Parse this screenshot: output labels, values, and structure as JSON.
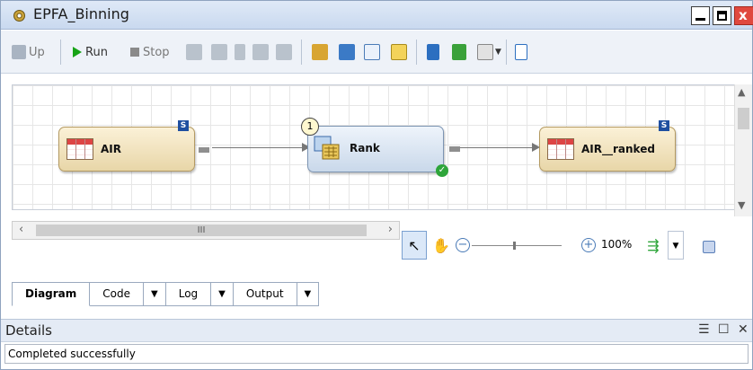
{
  "window": {
    "title": "EPFA_Binning"
  },
  "toolbar": {
    "up_label": "Up",
    "run_label": "Run",
    "stop_label": "Stop"
  },
  "diagram": {
    "nodes": [
      {
        "label": "AIR",
        "badge": "S"
      },
      {
        "label": "Rank",
        "step_number": "1",
        "status": "success"
      },
      {
        "label": "AIR__ranked",
        "badge": "S"
      }
    ]
  },
  "scroll": {
    "thumb_grip": "III"
  },
  "zoom": {
    "percent": "100%"
  },
  "tabs": [
    "Diagram",
    "Code",
    "Log",
    "Output"
  ],
  "details": {
    "title": "Details",
    "status_text": "Completed successfully"
  },
  "colors": {
    "node_fill": "#f3e4bd",
    "rank_fill": "#dce7f3",
    "run": "#17a317",
    "ok": "#2ea53a"
  }
}
